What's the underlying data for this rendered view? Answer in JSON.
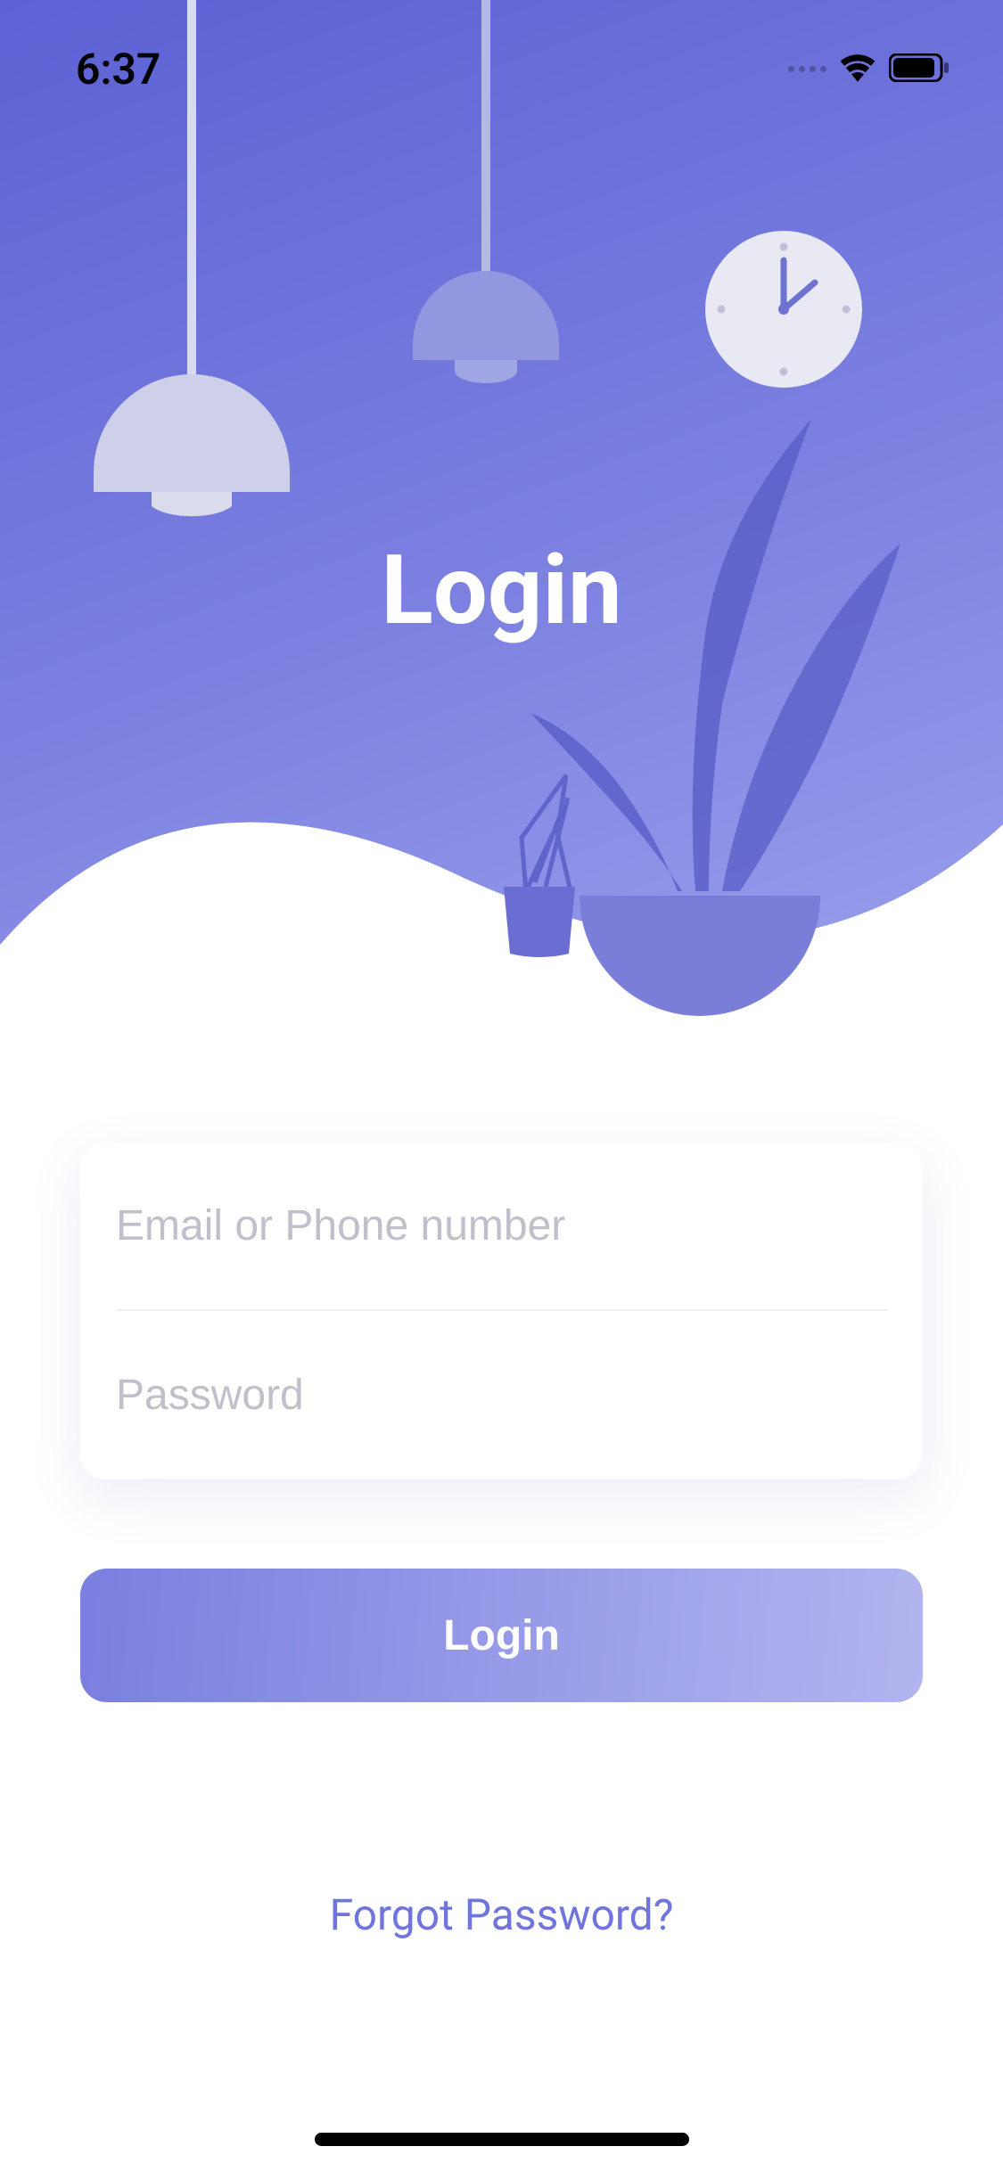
{
  "status": {
    "time": "6:37"
  },
  "title": "Login",
  "form": {
    "email_placeholder": "Email or Phone number",
    "password_placeholder": "Password"
  },
  "actions": {
    "login_label": "Login",
    "forgot_label": "Forgot Password?"
  },
  "colors": {
    "primary_start": "#5c61d4",
    "primary_mid": "#7a7fe0",
    "primary_end": "#9ea2ed",
    "link": "#7075de"
  }
}
